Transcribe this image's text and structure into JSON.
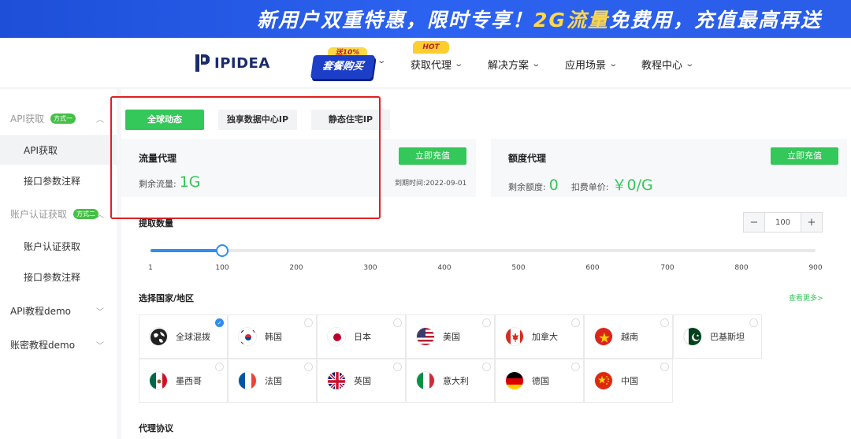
{
  "banner": {
    "text_a": "新用户双重特惠，限时专享！",
    "text_hl": "2G流量",
    "text_b": "免费用，充值最高再送"
  },
  "nav": {
    "logo": "IPIDEA",
    "promo_badge": "送10%",
    "promo_label": "套餐购买",
    "hot_badge": "HOT",
    "items": [
      "获取代理",
      "解决方案",
      "应用场景",
      "教程中心"
    ]
  },
  "sidebar": {
    "group1": "API获取",
    "group1_tag": "方式一",
    "group1_items": [
      "API获取",
      "接口参数注释"
    ],
    "group2": "账户认证获取",
    "group2_tag": "方式二",
    "group2_items": [
      "账户认证获取",
      "接口参数注释"
    ],
    "group3": "API教程demo",
    "group4": "账密教程demo"
  },
  "tabs": [
    "全球动态",
    "独享数据中心IP",
    "静态住宅IP"
  ],
  "flow_card": {
    "title": "流量代理",
    "remain_label": "剩余流量:",
    "remain_value": "1G",
    "button": "立即充值",
    "expire": "到期时间:2022-09-01"
  },
  "quota_card": {
    "title": "额度代理",
    "remain_label": "剩余额度:",
    "remain_value": "0",
    "price_label": "扣费单价:",
    "price_value": "￥0/G",
    "button": "立即充值"
  },
  "extract": {
    "label": "提取数量",
    "value": "100",
    "minus": "−",
    "plus": "+",
    "slider_min": 1,
    "slider_max": 900,
    "slider_value": 100,
    "ticks": [
      "1",
      "100",
      "200",
      "300",
      "400",
      "500",
      "600",
      "700",
      "800",
      "900"
    ]
  },
  "country": {
    "label": "选择国家/地区",
    "more": "查看更多>",
    "items": [
      {
        "name": "全球混拨",
        "icon": "globe-icon",
        "selected": true
      },
      {
        "name": "韩国",
        "icon": "flag-kr-icon"
      },
      {
        "name": "日本",
        "icon": "flag-jp-icon"
      },
      {
        "name": "美国",
        "icon": "flag-us-icon"
      },
      {
        "name": "加拿大",
        "icon": "flag-ca-icon"
      },
      {
        "name": "越南",
        "icon": "flag-vn-icon"
      },
      {
        "name": "巴基斯坦",
        "icon": "flag-pk-icon"
      },
      {
        "name": "墨西哥",
        "icon": "flag-mx-icon"
      },
      {
        "name": "法国",
        "icon": "flag-fr-icon"
      },
      {
        "name": "英国",
        "icon": "flag-gb-icon"
      },
      {
        "name": "意大利",
        "icon": "flag-it-icon"
      },
      {
        "name": "德国",
        "icon": "flag-de-icon"
      },
      {
        "name": "中国",
        "icon": "flag-cn-icon"
      }
    ]
  },
  "protocol": {
    "label": "代理协议"
  },
  "colors": {
    "accent_green": "#34c759",
    "banner_blue": "#2c62f0",
    "slider_blue": "#2f8cf0",
    "highlight_red": "#e02020"
  }
}
